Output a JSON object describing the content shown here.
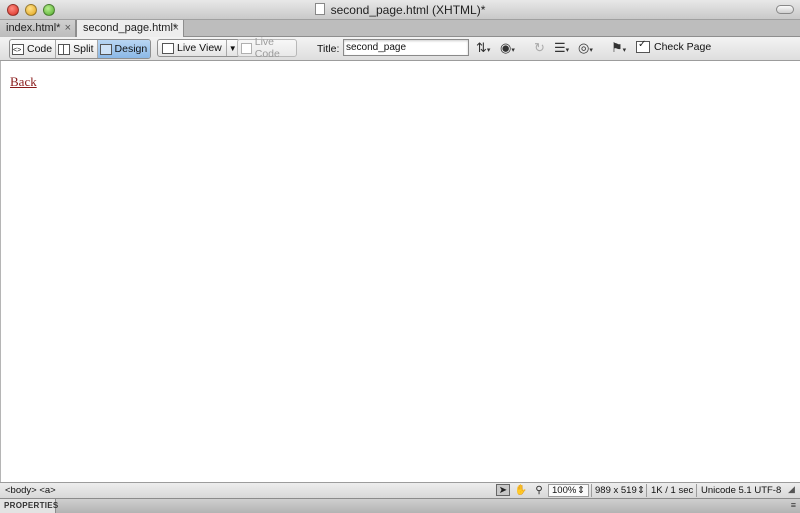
{
  "window": {
    "title": "second_page.html (XHTML)*"
  },
  "tabs": [
    {
      "label": "index.html*",
      "close": "×",
      "active": false
    },
    {
      "label": "second_page.html*",
      "close": "×",
      "active": true
    }
  ],
  "toolbar": {
    "view_modes": [
      {
        "label": "Code",
        "active": false
      },
      {
        "label": "Split",
        "active": false
      },
      {
        "label": "Design",
        "active": true
      }
    ],
    "live_view_label": "Live View",
    "live_code_label": "Live Code",
    "title_label": "Title:",
    "title_value": "second_page",
    "check_page_label": "Check Page"
  },
  "document": {
    "link_text": "Back",
    "link_color": "#8a1c1c"
  },
  "statusbar": {
    "tag_selector": "<body> <a>",
    "zoom": "100%",
    "window_size": "989 x 519",
    "download": "1K / 1 sec",
    "encoding": "Unicode 5.1 UTF-8"
  },
  "properties": {
    "label": "PROPERTIES"
  },
  "colors": {
    "active_tab": "#ededed",
    "active_mode": "#8bb8e6"
  }
}
